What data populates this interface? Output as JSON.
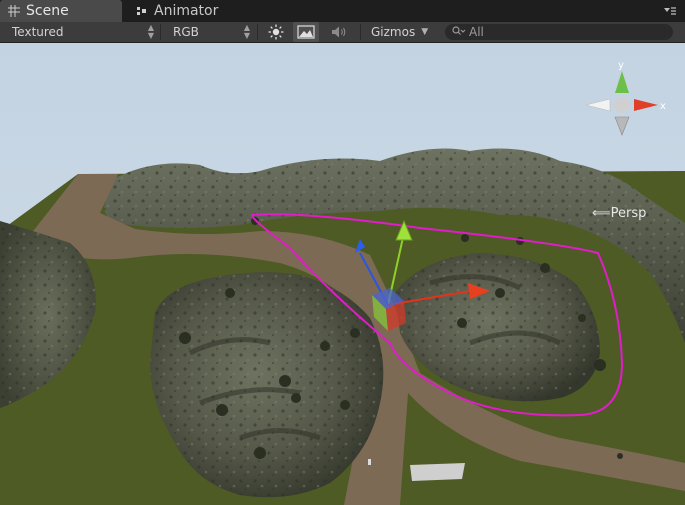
{
  "tabs": {
    "scene": {
      "label": "Scene",
      "icon": "grid-icon"
    },
    "animator": {
      "label": "Animator",
      "icon": "animator-icon"
    }
  },
  "toolbar": {
    "draw_mode": "Textured",
    "render_mode": "RGB",
    "gizmos_label": "Gizmos",
    "search_placeholder": "All"
  },
  "viewport": {
    "projection_label": "Persp",
    "orientation_axes": {
      "x": "x",
      "y": "y"
    }
  },
  "colors": {
    "sky": "#c7d6e3",
    "grass": "#4d5a22",
    "path": "#7c6a56",
    "rock": "#5a5e4e",
    "selection_outline": "#e11cc9",
    "axis_x": "#e3331a",
    "axis_y": "#8ed02b",
    "axis_z": "#2a56e0"
  }
}
